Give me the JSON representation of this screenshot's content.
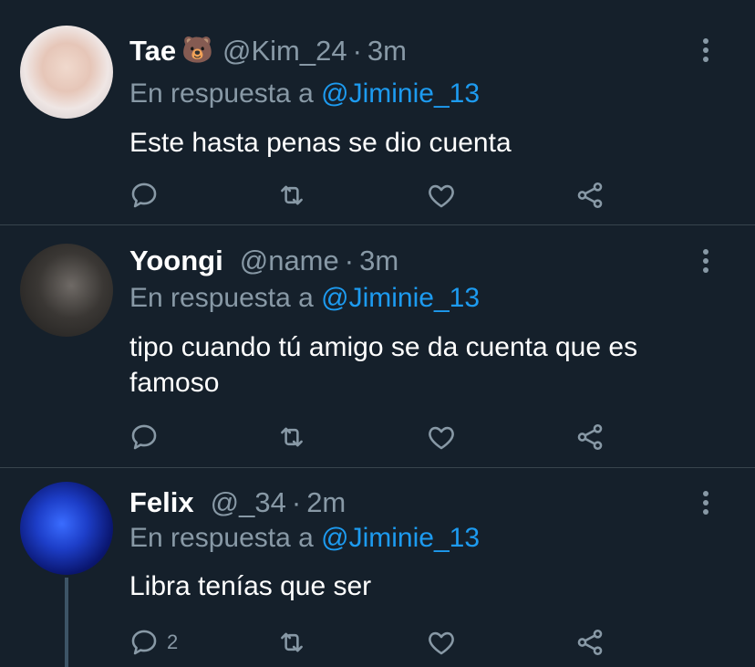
{
  "tweets": [
    {
      "name": "Tae",
      "emoji": "🐻",
      "handle": "@Kim_24",
      "time": "3m",
      "reply_prefix": "En respuesta a",
      "reply_mention": "@Jiminie_13",
      "text": "Este hasta penas se dio cuenta",
      "reply_count": ""
    },
    {
      "name": "Yoongi",
      "handle": "@name",
      "time": "3m",
      "reply_prefix": "En respuesta a",
      "reply_mention": "@Jiminie_13",
      "text": "tipo cuando tú amigo se da cuenta que es famoso",
      "reply_count": ""
    },
    {
      "name": "Felix",
      "handle": "@_34",
      "time": "2m",
      "reply_prefix": "En respuesta a",
      "reply_mention": "@Jiminie_13",
      "text": "Libra tenías que ser",
      "reply_count": "2"
    }
  ],
  "icons": {
    "reply": "reply-icon",
    "retweet": "retweet-icon",
    "like": "like-icon",
    "share": "share-icon",
    "more": "more-options-icon"
  },
  "colors": {
    "background": "#15202b",
    "secondary_text": "#8899a6",
    "mention": "#1d9bf0",
    "separator": "#38444d"
  }
}
